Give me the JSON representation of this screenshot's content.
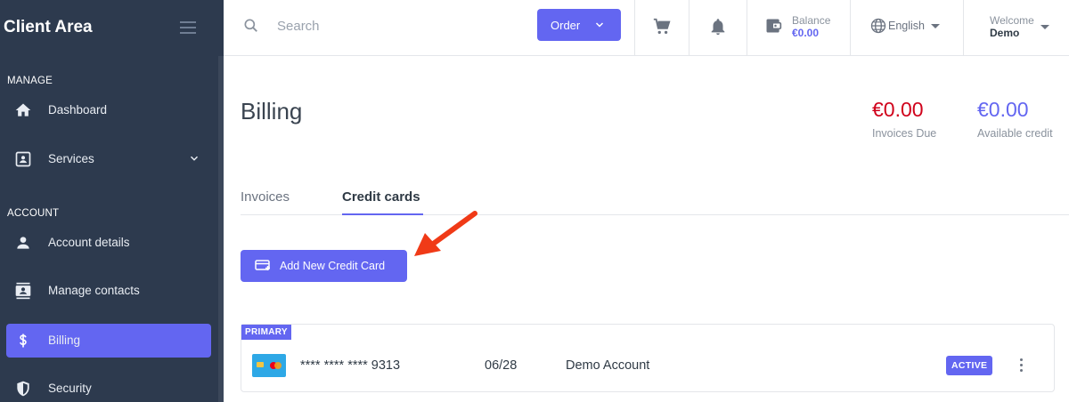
{
  "sidebar": {
    "brand": "Client Area",
    "sections": [
      {
        "label": "MANAGE"
      },
      {
        "label": "ACCOUNT"
      }
    ],
    "items": [
      {
        "label": "Dashboard",
        "icon": "home-icon"
      },
      {
        "label": "Services",
        "icon": "id-card-icon"
      },
      {
        "label": "Account details",
        "icon": "user-icon"
      },
      {
        "label": "Manage contacts",
        "icon": "contacts-icon"
      },
      {
        "label": "Billing",
        "icon": "dollar-icon",
        "active": true
      },
      {
        "label": "Security",
        "icon": "shield-icon"
      }
    ]
  },
  "header": {
    "search_placeholder": "Search",
    "order_label": "Order",
    "balance_label": "Balance",
    "balance_value": "€0.00",
    "language": "English",
    "welcome_label": "Welcome",
    "welcome_name": "Demo"
  },
  "main": {
    "title": "Billing",
    "invoices_due_value": "€0.00",
    "invoices_due_label": "Invoices Due",
    "available_credit_value": "€0.00",
    "available_credit_label": "Available credit",
    "tabs": [
      {
        "label": "Invoices",
        "active": false
      },
      {
        "label": "Credit cards",
        "active": true
      }
    ],
    "add_button_label": "Add New Credit Card",
    "card": {
      "badge": "PRIMARY",
      "number": "**** **** **** 9313",
      "expiry": "06/28",
      "holder": "Demo Account",
      "status": "ACTIVE"
    }
  },
  "colors": {
    "accent": "#6366f1",
    "sidebar_bg": "#2d3a4e",
    "due_red": "#d0021b",
    "arrow_red": "#f03a17"
  }
}
